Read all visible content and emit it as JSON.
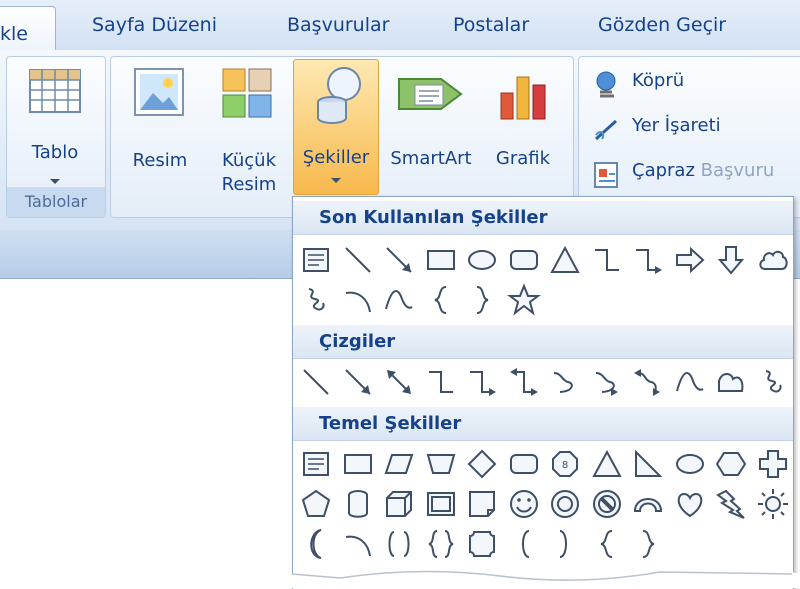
{
  "tabs": [
    "kle",
    "Sayfa Düzeni",
    "Başvurular",
    "Postalar",
    "Gözden Geçir"
  ],
  "groups": {
    "tablolar": {
      "label": "Tablolar",
      "tablo": "Tablo"
    },
    "illustrations": {
      "resim": "Resim",
      "kucuk_resim": [
        "Küçük",
        "Resim"
      ],
      "sekiller": "Şekiller",
      "smartart": "SmartArt",
      "grafik": "Grafik"
    },
    "links": {
      "kopru": "Köprü",
      "yer_isareti": "Yer İşareti",
      "capraz": "Çapraz",
      "basvuru": "Başvuru"
    }
  },
  "dropdown": {
    "section1": "Son Kullanılan Şekiller",
    "section2": "Çizgiler",
    "section3": "Temel Şekiller"
  },
  "colors": {
    "accent_orange": "#f8b84c",
    "ribbon_text": "#15428b"
  }
}
